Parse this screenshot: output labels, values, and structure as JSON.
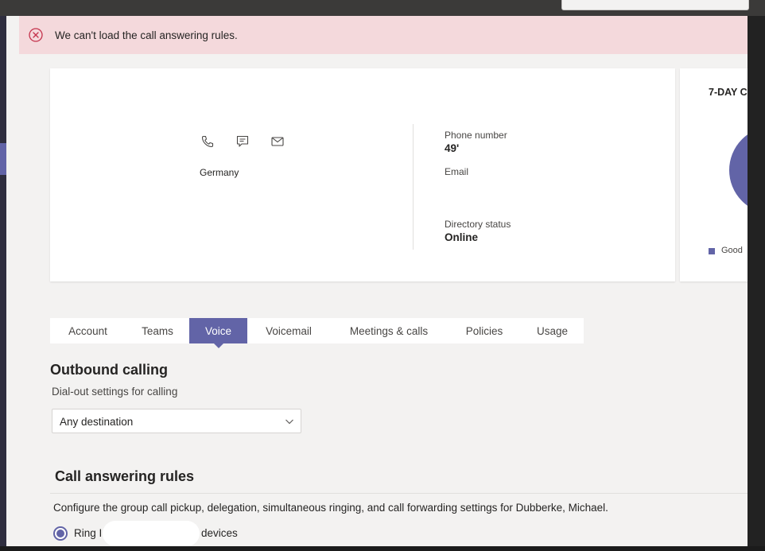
{
  "banner": {
    "message": "We can't load the call answering rules.",
    "icon": "error-circle-icon",
    "color": "#f4d9dc"
  },
  "profile": {
    "country": "Germany",
    "actions": [
      "phone-icon",
      "chat-icon",
      "mail-icon"
    ],
    "phone_label": "Phone number",
    "phone_value": "49'",
    "email_label": "Email",
    "email_value": "",
    "directory_label": "Directory status",
    "directory_value": "Online"
  },
  "stats": {
    "title": "7-DAY C",
    "legend_good": "Good",
    "accent": "#6264a7"
  },
  "tabs": [
    {
      "label": "Account",
      "active": false
    },
    {
      "label": "Teams",
      "active": false
    },
    {
      "label": "Voice",
      "active": true
    },
    {
      "label": "Voicemail",
      "active": false
    },
    {
      "label": "Meetings & calls",
      "active": false
    },
    {
      "label": "Policies",
      "active": false
    },
    {
      "label": "Usage",
      "active": false
    }
  ],
  "outbound": {
    "title": "Outbound calling",
    "subtitle": "Dial-out settings for calling",
    "dropdown_value": "Any destination"
  },
  "call_answering": {
    "title": "Call answering rules",
    "description": "Configure the group call pickup, delegation, simultaneous ringing, and call forwarding settings for Dubberke, Michael.",
    "radio_prefix": "Ring I",
    "radio_suffix": "devices"
  }
}
